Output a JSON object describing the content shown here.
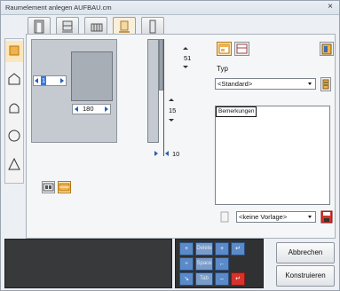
{
  "window": {
    "title": "Raumelement anlegen AUFBAU.cm",
    "close_label": "×"
  },
  "tabs": [
    {
      "icon": "door-frame-icon"
    },
    {
      "icon": "window-frame-icon"
    },
    {
      "icon": "radiator-icon"
    },
    {
      "icon": "niche-icon",
      "active": true
    },
    {
      "icon": "column-icon"
    }
  ],
  "shapes": [
    {
      "icon": "square-shape-icon",
      "active": true
    },
    {
      "icon": "pentagon-shape-icon"
    },
    {
      "icon": "arch-shape-icon"
    },
    {
      "icon": "circle-shape-icon"
    },
    {
      "icon": "triangle-shape-icon"
    }
  ],
  "dimensions": {
    "left_offset": "1",
    "width": "180",
    "top_value": "51",
    "height_value": "15",
    "depth_value": "10"
  },
  "type_section": {
    "label": "Typ",
    "selected": "<Standard>"
  },
  "notes": {
    "label": "Bemerkungen"
  },
  "template": {
    "selected": "<keine Vorlage>"
  },
  "keypad": {
    "keys": [
      "+",
      "Delete",
      "+",
      "↵",
      "÷",
      "Space",
      "←",
      "↘",
      "Tab",
      "–",
      "↵"
    ]
  },
  "buttons": {
    "cancel": "Abbrechen",
    "construct": "Konstruieren"
  },
  "colors": {
    "accent_orange": "#e89c2a",
    "keypad_blue": "#5b8ac9",
    "keypad_red": "#d8332b"
  }
}
